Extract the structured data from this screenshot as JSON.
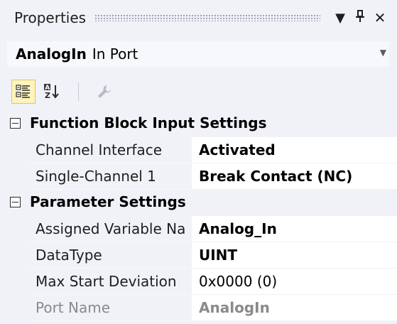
{
  "window": {
    "title": "Properties",
    "pin_glyph": "Ԅ",
    "dropdown_glyph": "▼",
    "close_glyph": "✕"
  },
  "object_selector": {
    "name": "AnalogIn",
    "type": "In Port"
  },
  "toolbar": {
    "tools": [
      {
        "icon": "categorized-icon",
        "selected": true
      },
      {
        "icon": "alphabetical-sort-icon",
        "selected": false
      },
      {
        "icon": "property-pages-wrench-icon",
        "selected": false,
        "disabled": true
      }
    ]
  },
  "categories": [
    {
      "label": "Function Block Input Settings",
      "expanded": true,
      "properties": [
        {
          "name": "Channel Interface",
          "value": "Activated",
          "bold": true,
          "readonly": false
        },
        {
          "name": "Single-Channel 1",
          "value": "Break Contact (NC)",
          "bold": true,
          "readonly": false
        }
      ]
    },
    {
      "label": "Parameter Settings",
      "expanded": true,
      "properties": [
        {
          "name": "Assigned Variable Na",
          "value": "Analog_In",
          "bold": true,
          "readonly": false
        },
        {
          "name": "DataType",
          "value": "UINT",
          "bold": true,
          "readonly": false
        },
        {
          "name": "Max Start Deviation",
          "value": "0x0000 (0)",
          "bold": false,
          "readonly": false
        },
        {
          "name": "Port Name",
          "value": "AnalogIn",
          "bold": true,
          "readonly": true
        }
      ]
    }
  ],
  "colors": {
    "panel_bg": "#f1f2f7",
    "value_bg": "#ffffff",
    "selected_tool_bg": "#fdf4bf",
    "readonly_text": "#8a8a8a"
  }
}
